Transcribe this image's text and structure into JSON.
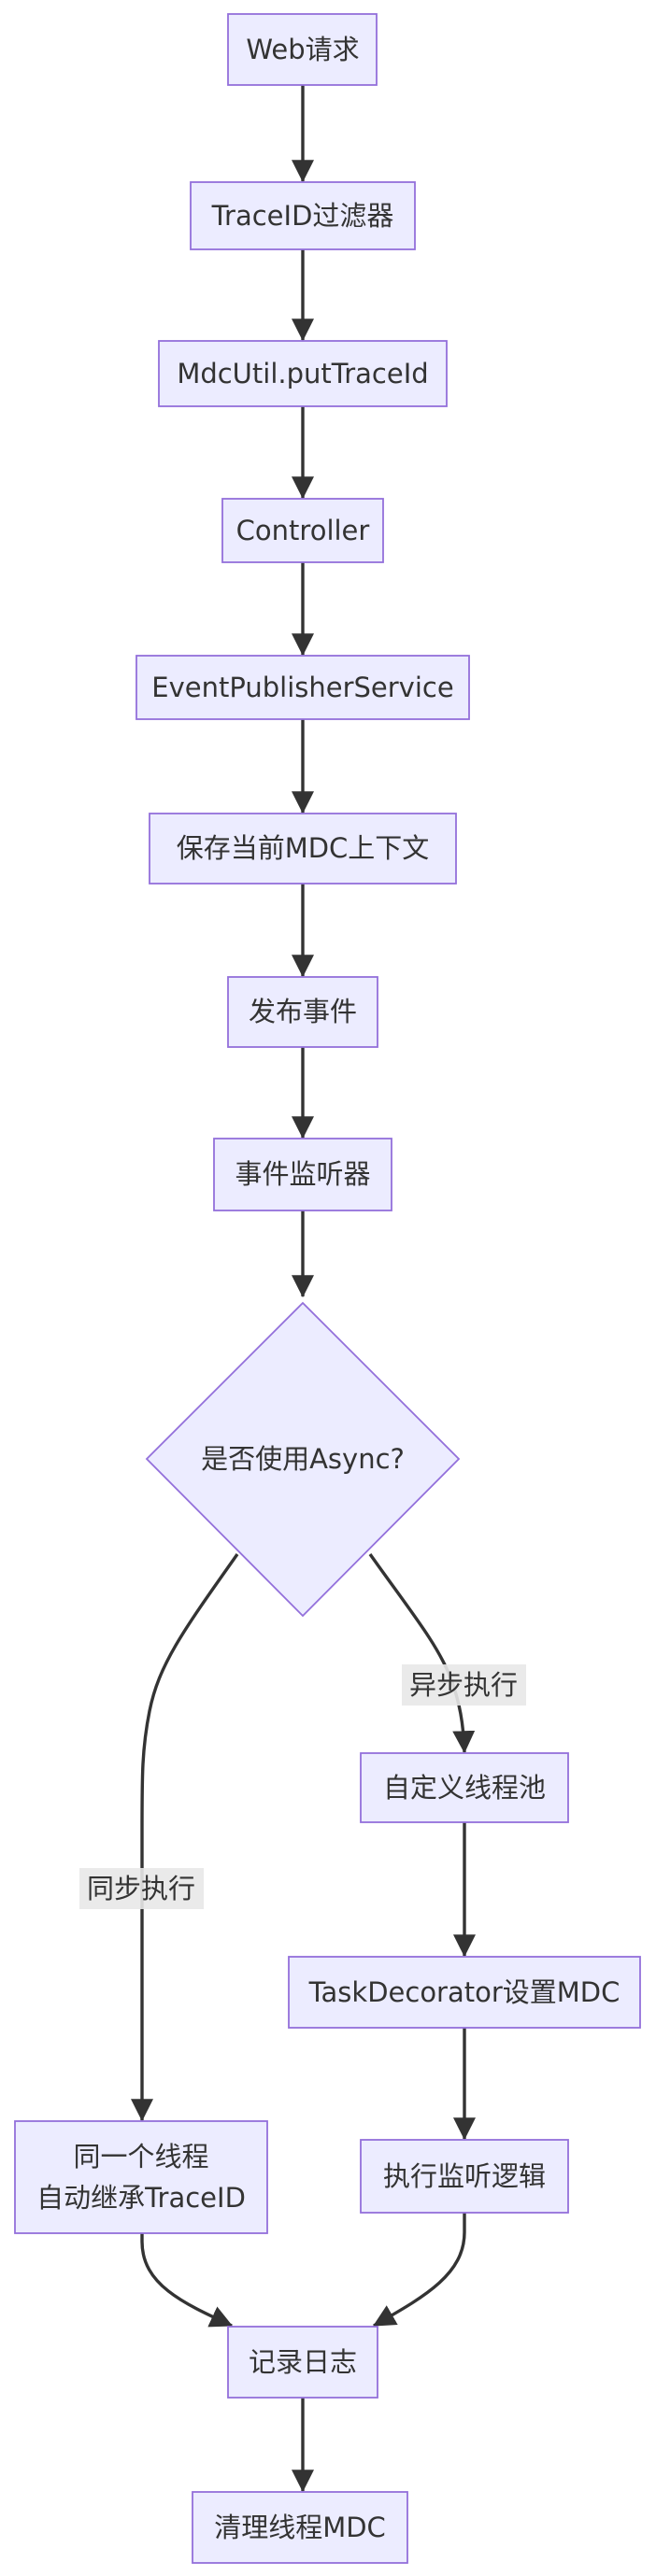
{
  "diagram": {
    "nodes": {
      "web_request": "Web请求",
      "traceid_filter": "TraceID过滤器",
      "mdc_put": "MdcUtil.putTraceId",
      "controller": "Controller",
      "event_publisher": "EventPublisherService",
      "save_mdc": "保存当前MDC上下文",
      "publish_event": "发布事件",
      "event_listener": "事件监听器",
      "use_async": "是否使用Async?",
      "custom_pool": "自定义线程池",
      "task_decorator": "TaskDecorator设置MDC",
      "same_thread_line1": "同一个线程",
      "same_thread_line2": "自动继承TraceID",
      "run_listener": "执行监听逻辑",
      "write_log": "记录日志",
      "clear_mdc": "清理线程MDC"
    },
    "edge_labels": {
      "async": "异步执行",
      "sync": "同步执行"
    },
    "colors": {
      "node_fill": "#ECECFF",
      "node_stroke": "#9370DB",
      "edge": "#333333",
      "text": "#333333",
      "edge_label_bg": "#E8E8E8"
    }
  }
}
